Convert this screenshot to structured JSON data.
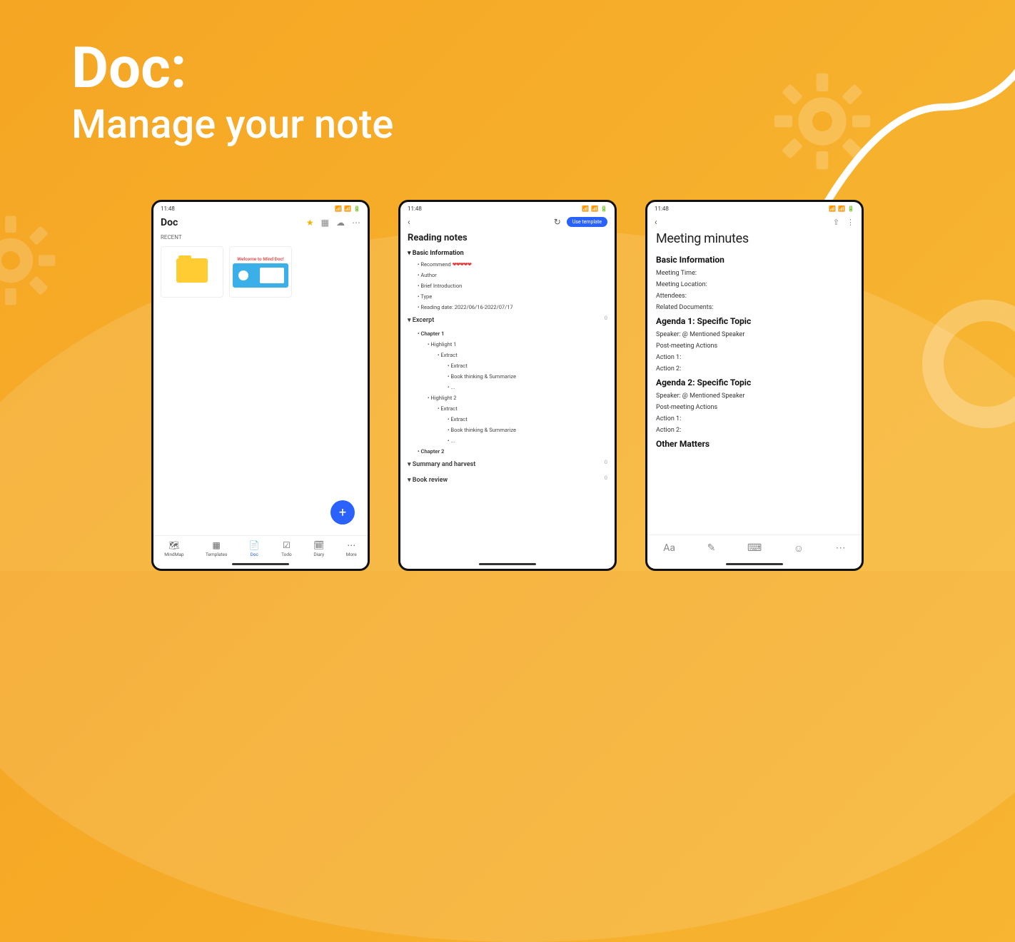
{
  "hero": {
    "title": "Doc:",
    "subtitle": "Manage your note"
  },
  "statusbar": {
    "time": "11:48"
  },
  "phone1": {
    "title": "Doc",
    "section_label": "RECENT",
    "cards": [
      {
        "type": "folder",
        "name": "",
        "caption": ""
      },
      {
        "type": "welcome",
        "name": "Welcome to Mind Doc!",
        "caption": ""
      }
    ],
    "nav": [
      {
        "icon": "🗺",
        "label": "MindMap"
      },
      {
        "icon": "▦",
        "label": "Templates"
      },
      {
        "icon": "📄",
        "label": "Doc",
        "active": true
      },
      {
        "icon": "☑",
        "label": "Todo"
      },
      {
        "icon": "🗓",
        "label": "Diary"
      },
      {
        "icon": "⋯",
        "label": "More"
      }
    ]
  },
  "phone2": {
    "pill": "Use template",
    "title": "Reading notes",
    "sections": [
      {
        "heading": "Basic Information",
        "items": [
          {
            "text": "Recommend",
            "hearts": "❤❤❤❤❤",
            "indent": 1
          },
          {
            "text": "Author",
            "indent": 1
          },
          {
            "text": "Brief Introduction",
            "indent": 1
          },
          {
            "text": "Type",
            "indent": 1
          },
          {
            "text": "Reading date: 2022/06/16-2022/07/17",
            "indent": 1
          }
        ]
      },
      {
        "heading": "Excerpt",
        "trail": "0",
        "items": [
          {
            "text": "Chapter 1",
            "indent": 1,
            "bold": true
          },
          {
            "text": "Highlight 1",
            "indent": 2
          },
          {
            "text": "Extract",
            "indent": 3
          },
          {
            "text": "Extract",
            "indent": 4
          },
          {
            "text": "Book thinking & Summarize",
            "indent": 4
          },
          {
            "text": "...",
            "indent": 4
          },
          {
            "text": "Highlight 2",
            "indent": 2
          },
          {
            "text": "Extract",
            "indent": 3
          },
          {
            "text": "Extract",
            "indent": 4
          },
          {
            "text": "Book thinking & Summarize",
            "indent": 4
          },
          {
            "text": "...",
            "indent": 4
          },
          {
            "text": "Chapter 2",
            "indent": 1,
            "bold": true
          }
        ]
      },
      {
        "heading": "Summary and harvest",
        "trail": "0",
        "items": []
      },
      {
        "heading": "Book review",
        "trail": "0",
        "items": []
      }
    ]
  },
  "phone3": {
    "title": "Meeting minutes",
    "blocks": [
      {
        "heading": "Basic Information",
        "items": [
          "Meeting Time:",
          "Meeting Location:",
          "Attendees:",
          "Related Documents:"
        ]
      },
      {
        "heading": "Agenda 1: Specific Topic",
        "items": [
          "Speaker: @ Mentioned Speaker",
          "Post-meeting Actions",
          "Action 1:",
          "Action 2:"
        ]
      },
      {
        "heading": "Agenda 2: Specific Topic",
        "items": [
          "Speaker: @ Mentioned Speaker",
          "Post-meeting Actions",
          "Action 1:",
          "Action 2:"
        ]
      },
      {
        "heading": "Other Matters",
        "items": []
      }
    ],
    "toolbar_icons": [
      "Aa",
      "✎",
      "⌨",
      "☺",
      "⋯"
    ]
  }
}
